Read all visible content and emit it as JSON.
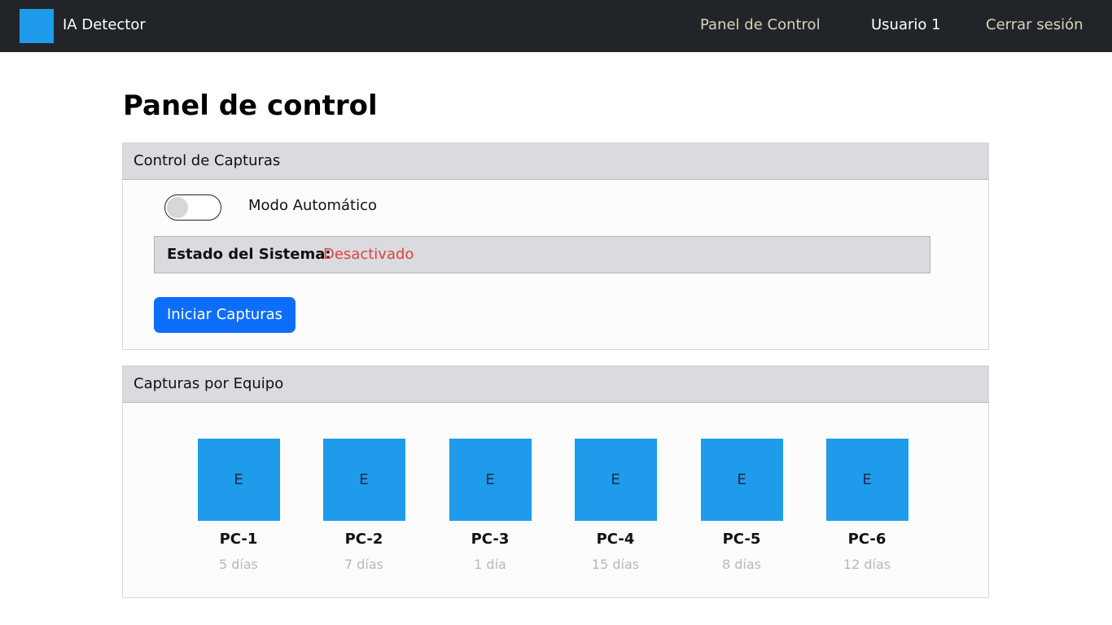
{
  "navbar": {
    "brand": "IA Detector",
    "links": {
      "panel": "Panel de Control",
      "user": "Usuario 1",
      "logout": "Cerrar sesión"
    }
  },
  "page": {
    "title": "Panel de control"
  },
  "capture_control": {
    "header": "Control de Capturas",
    "auto_mode_label": "Modo Automático",
    "auto_mode_on": false,
    "status_label": "Estado del Sistema:",
    "status_value": "Desactivado",
    "start_button": "Iniciar Capturas"
  },
  "captures_by_device": {
    "header": "Capturas por Equipo",
    "devices": [
      {
        "thumb": "E",
        "name": "PC-1",
        "age": "5 días"
      },
      {
        "thumb": "E",
        "name": "PC-2",
        "age": "7 días"
      },
      {
        "thumb": "E",
        "name": "PC-3",
        "age": "1 día"
      },
      {
        "thumb": "E",
        "name": "PC-4",
        "age": "15 días"
      },
      {
        "thumb": "E",
        "name": "PC-5",
        "age": "8 días"
      },
      {
        "thumb": "E",
        "name": "PC-6",
        "age": "12 días"
      }
    ]
  },
  "colors": {
    "navbar": "#212529",
    "accent_blue": "#1e9bea",
    "button_blue": "#0d6efd",
    "status_red": "#e0413f"
  }
}
